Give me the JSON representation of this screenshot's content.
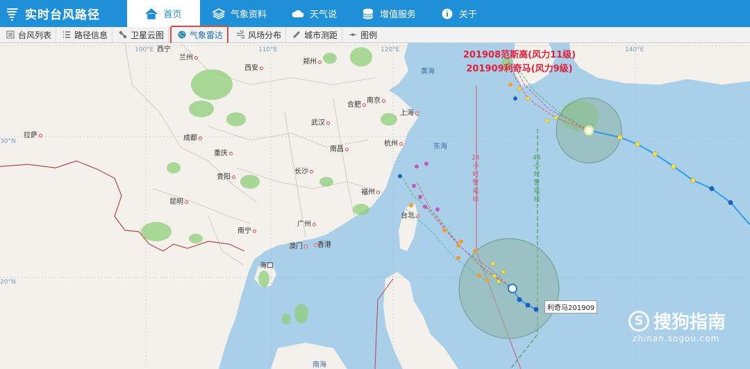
{
  "app": {
    "title": "实时台风路径"
  },
  "nav": [
    {
      "label": "首页",
      "icon": "home-icon",
      "active": true
    },
    {
      "label": "气象资料",
      "icon": "stack-icon",
      "active": false
    },
    {
      "label": "天气说",
      "icon": "cloud-icon",
      "active": false
    },
    {
      "label": "增值服务",
      "icon": "database-icon",
      "active": false
    },
    {
      "label": "关于",
      "icon": "info-icon",
      "active": false
    }
  ],
  "toolbar": [
    {
      "label": "台风列表",
      "icon": "list-icon"
    },
    {
      "label": "路径信息",
      "icon": "path-list-icon"
    },
    {
      "label": "卫星云图",
      "icon": "satellite-icon"
    },
    {
      "label": "气象雷达",
      "icon": "radar-globe-icon",
      "active": true
    },
    {
      "label": "风场分布",
      "icon": "wind-icon"
    },
    {
      "label": "城市测距",
      "icon": "ruler-icon"
    },
    {
      "label": "图例",
      "icon": "legend-icon"
    }
  ],
  "map": {
    "storm_titles": [
      "201908范斯高(风力11级)",
      "201909利奇马(风力9级)"
    ],
    "storm_tag": "利奇马201909",
    "warn_24": "24小时警戒线",
    "warn_48": "48小时警戒线",
    "grid": {
      "lon_100": "100°E",
      "lon_110": "110°E",
      "lon_120": "120°E",
      "lon_140": "140°E",
      "lat_30": "30°N",
      "lat_20": "20°N"
    },
    "cities": {
      "xining": "西宁",
      "lanzhou": "兰州",
      "xian": "西安",
      "zhengzhou": "郑州",
      "hefei": "合肥",
      "nanjing": "南京",
      "shanghai": "上海",
      "wuhan": "武汉",
      "lasa": "拉萨",
      "chengdu": "成都",
      "chongqing": "重庆",
      "hangzhou": "杭州",
      "nanchang": "南昌",
      "changsha": "长沙",
      "guiyang": "贵阳",
      "fuzhou": "福州",
      "kunming": "昆明",
      "taipei": "台北",
      "guangzhou": "广州",
      "nanning": "南宁",
      "macau": "澳门",
      "hongkong": "香港",
      "haikou": "海口"
    },
    "seas": {
      "yellow": "黄海",
      "east": "东海",
      "south": "南海"
    }
  },
  "watermark": {
    "main": "搜狗指南",
    "sub": "zhinan.sogou.com"
  },
  "colors": {
    "brand": "#1f8fd8",
    "land": "#f4f1ec",
    "sea": "#a9cfe9",
    "highlight": "#e24b3b",
    "title_red": "#e0203a"
  }
}
